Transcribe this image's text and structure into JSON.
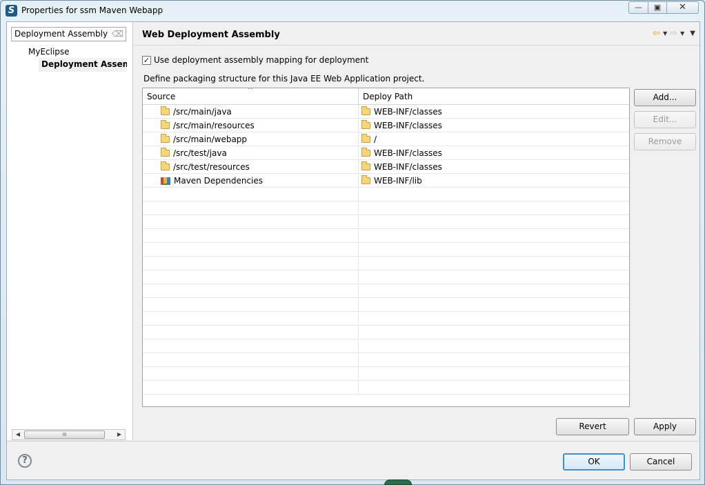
{
  "window": {
    "title": "Properties for ssm Maven Webapp",
    "app_icon": "S",
    "minimize_glyph": "—",
    "maximize_glyph": "▣",
    "close_glyph": "✕"
  },
  "nav": {
    "filter_value": "Deployment Assembly",
    "filter_clear_icon": "eraser-icon",
    "tree_root": "MyEclipse",
    "tree_selected": "Deployment Assembly",
    "scroll_thumb": "III"
  },
  "page": {
    "title": "Web Deployment Assembly",
    "history": {
      "back": "⇦",
      "forward": "⇨",
      "dropdown": "▼",
      "menu": "▼"
    },
    "checkbox_label": "Use deployment assembly mapping for deployment",
    "checkbox_checked": true,
    "description": "Define packaging structure for this Java EE Web Application project."
  },
  "table": {
    "columns": [
      "Source",
      "Deploy Path"
    ],
    "sort_indicator": "^",
    "rows": [
      {
        "source": "/src/main/java",
        "source_icon": "folder-icon",
        "deploy": "WEB-INF/classes"
      },
      {
        "source": "/src/main/resources",
        "source_icon": "folder-icon",
        "deploy": "WEB-INF/classes"
      },
      {
        "source": "/src/main/webapp",
        "source_icon": "folder-icon",
        "deploy": "/"
      },
      {
        "source": "/src/test/java",
        "source_icon": "folder-icon",
        "deploy": "WEB-INF/classes"
      },
      {
        "source": "/src/test/resources",
        "source_icon": "folder-icon",
        "deploy": "WEB-INF/classes"
      },
      {
        "source": "Maven Dependencies",
        "source_icon": "library-icon",
        "deploy": "WEB-INF/lib"
      }
    ],
    "empty_row_count": 15
  },
  "buttons": {
    "add": "Add...",
    "edit": "Edit...",
    "remove": "Remove",
    "revert": "Revert",
    "apply": "Apply",
    "ok": "OK",
    "cancel": "Cancel",
    "help": "?"
  },
  "colors": {
    "accent": "#3c8fd4",
    "folder": "#f5d67a"
  }
}
